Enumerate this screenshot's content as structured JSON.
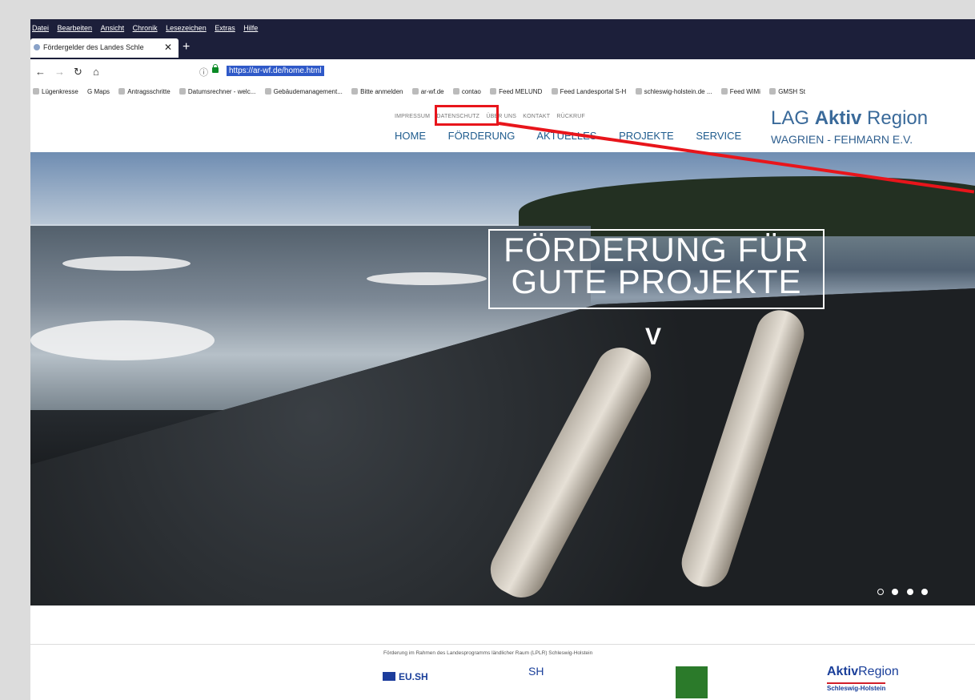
{
  "menubar": [
    "Datei",
    "Bearbeiten",
    "Ansicht",
    "Chronik",
    "Lesezeichen",
    "Extras",
    "Hilfe"
  ],
  "tab": {
    "title": "Fördergelder des Landes Schle"
  },
  "url": "https://ar-wf.de/home.html",
  "bookmarks": [
    "Lügenkresse",
    "G Maps",
    "Antragsschritte",
    "Datumsrechner - welc...",
    "Gebäudemanagement...",
    "Bitte anmelden",
    "ar-wf.de",
    "contao",
    "Feed MELUND",
    "Feed Landesportal S-H",
    "schleswig-holstein.de ...",
    "Feed WiMi",
    "GMSH St"
  ],
  "site": {
    "topnav": [
      "IMPRESSUM",
      "DATENSCHUTZ",
      "ÜBER UNS",
      "KONTAKT",
      "RÜCKRUF"
    ],
    "mainnav": [
      "HOME",
      "FÖRDERUNG",
      "AKTUELLES",
      "PROJEKTE",
      "SERVICE"
    ],
    "logo_line1_a": "LAG ",
    "logo_line1_b": "Aktiv",
    "logo_line1_c": " Region",
    "logo_line2": "WAGRIEN - FEHMARN E.V."
  },
  "hero": {
    "line1": "FÖRDERUNG FÜR",
    "line2": "GUTE PROJEKTE",
    "chevron": "V"
  },
  "footer": {
    "text": "Förderung im Rahmen des Landesprogramms ländlicher Raum (LPLR) Schleswig-Holstein",
    "eu": "EU.SH",
    "sh": "SH",
    "aktiv_a": "Aktiv",
    "aktiv_b": "Region",
    "aktiv_sub": "Schleswig-Holstein"
  },
  "colors": {
    "annotation": "#e8151b",
    "nav": "#1f5c8e",
    "chrome": "#1c1f3a"
  }
}
